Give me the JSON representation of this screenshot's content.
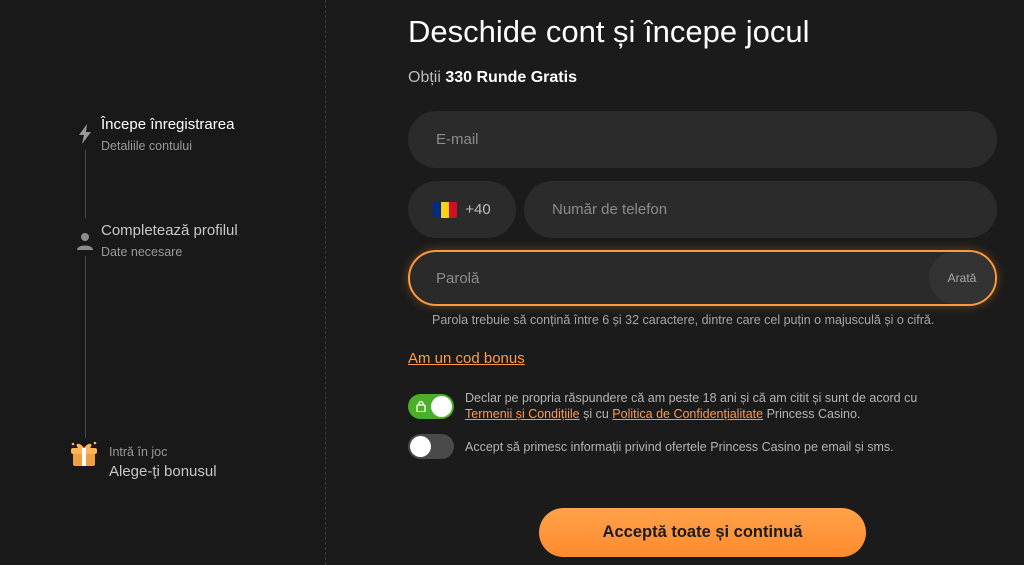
{
  "steps": [
    {
      "title": "Începe înregistrarea",
      "subtitle": "Detaliile contului",
      "icon": "lightning-icon"
    },
    {
      "title": "Completează profilul",
      "subtitle": "Date necesare",
      "icon": "user-icon"
    },
    {
      "title": "Alege-ți bonusul",
      "subtitle": "Intră în joc",
      "icon": "gift-icon"
    }
  ],
  "form": {
    "title": "Deschide cont și începe jocul",
    "subtitle_prefix": "Obții",
    "subtitle_bold": "330 Runde Gratis",
    "email_placeholder": "E-mail",
    "country_code": "+40",
    "phone_placeholder": "Număr de telefon",
    "password_placeholder": "Parolă",
    "show_label": "Arată",
    "password_hint": "Parola trebuie să conțină între 6 și 32 caractere, dintre care cel puțin o majusculă și o cifră.",
    "bonus_link": "Am un cod bonus",
    "consent1": {
      "text1": "Declar pe propria răspundere că am peste 18 ani și că am citit și sunt de acord cu",
      "terms_link": "Termenii și Condițiile",
      "text2": "și cu",
      "privacy_link": "Politica de Confidențialitate",
      "text3": "Princess Casino."
    },
    "consent2": "Accept să primesc informații privind ofertele Princess Casino pe email și sms.",
    "submit_label": "Acceptă toate și continuă"
  },
  "colors": {
    "accent": "#ff9a3c",
    "toggle_on": "#4caf2a",
    "flag": [
      "#002b7f",
      "#fcd116",
      "#ce1126"
    ]
  }
}
